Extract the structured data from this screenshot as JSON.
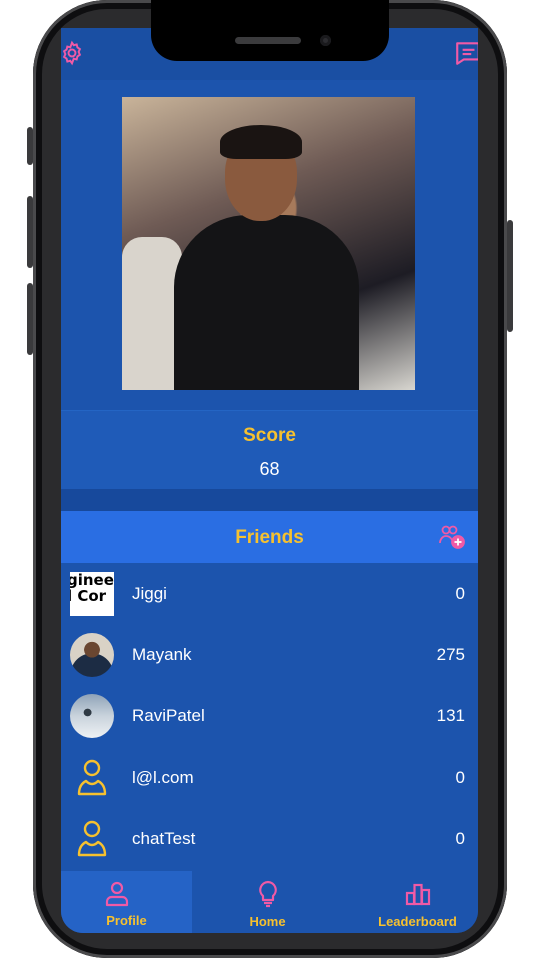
{
  "header": {
    "settings_icon": "gear-icon",
    "chat_icon": "chat-icon"
  },
  "profile": {
    "score_label": "Score",
    "score_value": "68"
  },
  "friends": {
    "title": "Friends",
    "add_icon": "add-friend-icon",
    "items": [
      {
        "name": "Jiggi",
        "score": "0",
        "avatar": "logo"
      },
      {
        "name": "Mayank",
        "score": "275",
        "avatar": "photo"
      },
      {
        "name": "RaviPatel",
        "score": "131",
        "avatar": "photo"
      },
      {
        "name": "l@l.com",
        "score": "0",
        "avatar": "user-icon"
      },
      {
        "name": "chatTest",
        "score": "0",
        "avatar": "user-icon"
      }
    ]
  },
  "nav": {
    "profile": "Profile",
    "home": "Home",
    "leaderboard": "Leaderboard"
  },
  "colors": {
    "accent_yellow": "#f6c12f",
    "accent_pink": "#f05aa6",
    "background_blue": "#1c54ad",
    "header_blue": "#2a6ee3"
  }
}
